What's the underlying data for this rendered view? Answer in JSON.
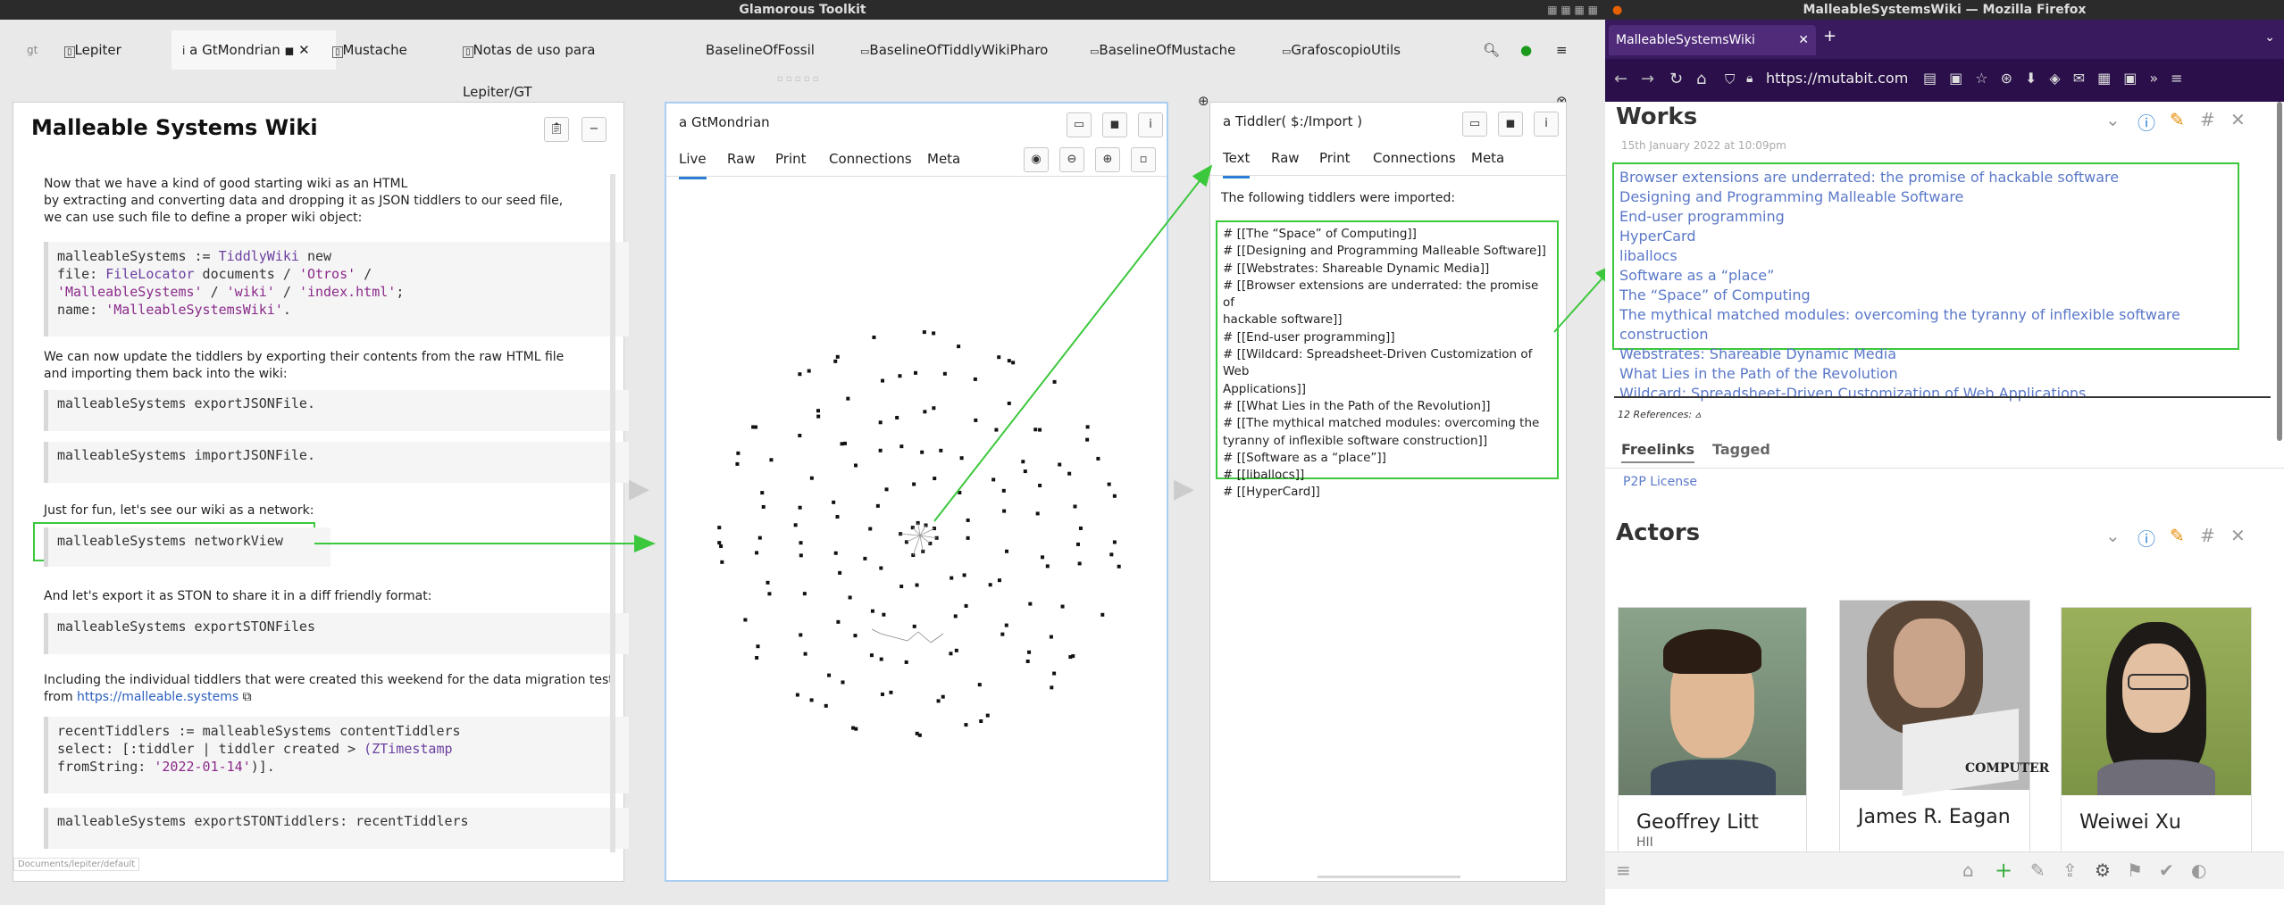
{
  "desktop": {},
  "gt": {
    "window_title": "Glamorous Toolkit",
    "tabs": [
      {
        "label": "Lepiter"
      },
      {
        "label": "a GtMondrian"
      },
      {
        "label": "Mustache"
      },
      {
        "label": "Notas de uso para Lepiter/GT"
      },
      {
        "label": "BaselineOfFossil"
      },
      {
        "label": "BaselineOfTiddlyWikiPharo"
      },
      {
        "label": "BaselineOfMustache"
      },
      {
        "label": "GrafoscopioUtils"
      }
    ],
    "page": {
      "title": "Malleable Systems Wiki",
      "p1_line1": "Now that we have a kind of good starting wiki as an HTML",
      "p1_line2": "by extracting and converting data and dropping it as JSON tiddlers to our seed file,",
      "p1_line3": "we can use such file to define a proper wiki object:",
      "code1_line1_a": "malleableSystems := ",
      "code1_line1_b": "TiddlyWiki",
      "code1_line1_c": " new",
      "code1_line2_a": "    file: ",
      "code1_line2_b": "FileLocator",
      "code1_line2_c": " documents / ",
      "code1_line2_d": "'Otros'",
      "code1_line2_e": " /",
      "code1_line3_a": "'MalleableSystems'",
      "code1_line3_b": " / ",
      "code1_line3_c": "'wiki'",
      "code1_line3_d": " / ",
      "code1_line3_e": "'index.html'",
      "code1_line3_f": ";",
      "code1_line4_a": "    name: ",
      "code1_line4_b": "'MalleableSystemsWiki'",
      "code1_line4_c": ".",
      "p2_line1": "We can now update the tiddlers by exporting their contents from the raw HTML file",
      "p2_line2": "and importing them back into the wiki:",
      "code2": "malleableSystems exportJSONFile.",
      "code3": "malleableSystems importJSONFile.",
      "p3": "Just for fun, let's see our wiki as a network:",
      "code4": "malleableSystems networkView",
      "p4": "And let's export it as STON to share it in a diff friendly format:",
      "code5": "malleableSystems exportSTONFiles",
      "p5_line1": "Including the individual tiddlers that were created this weekend for the data migration test",
      "p5_line2_a": "from ",
      "p5_line2_link": "https://malleable.systems",
      "code6_line1_a": "recentTiddlers := ",
      "code6_line1_b": "malleableSystems contentTiddlers",
      "code6_line2_a": "    select: [:tiddler | tiddler created > ",
      "code6_line2_b": "(ZTimestamp",
      "code6_line3_a": "fromString: ",
      "code6_line3_b": "'2022-01-14'",
      "code6_line3_c": ")].",
      "code7_a": "malleableSystems exportSTONTiddlers: ",
      "code7_b": "recentTiddlers",
      "footer_path": "Documents/lepiter/default"
    },
    "mondrian": {
      "title": "a GtMondrian",
      "subtabs": [
        "Live",
        "Raw",
        "Print",
        "Connections",
        "Meta"
      ]
    },
    "tiddler": {
      "title": "a Tiddler( $:/Import )",
      "subtabs": [
        "Text",
        "Raw",
        "Print",
        "Connections",
        "Meta"
      ],
      "intro": "The following tiddlers were imported:",
      "lines": [
        "# [[The “Space” of Computing]]",
        "# [[Designing and Programming Malleable Software]]",
        "# [[Webstrates: Shareable Dynamic Media]]",
        "# [[Browser extensions are underrated: the promise of",
        "hackable software]]",
        "# [[End-user programming]]",
        "# [[Wildcard: Spreadsheet-Driven Customization of Web",
        "Applications]]",
        "# [[What Lies in the Path of the Revolution]]",
        "# [[The mythical matched modules: overcoming the",
        "tyranny of inflexible software construction]]",
        "# [[Software as a “place”]]",
        "# [[liballocs]]",
        "# [[HyperCard]]"
      ]
    }
  },
  "firefox": {
    "window_title": "MalleableSystemsWiki — Mozilla Firefox",
    "tab_label": "MalleableSystemsWiki",
    "url": "https://mutabit.com",
    "works": {
      "title": "Works",
      "date": "15th January 2022 at 10:09pm",
      "items": [
        "Browser extensions are underrated: the promise of hackable software",
        "Designing and Programming Malleable Software",
        "End-user programming",
        "HyperCard",
        "liballocs",
        "Software as a “place”",
        "The “Space” of Computing",
        "The mythical matched modules: overcoming the tyranny of inflexible software construction",
        "Webstrates: Shareable Dynamic Media",
        "What Lies in the Path of the Revolution",
        "Wildcard: Spreadsheet-Driven Customization of Web Applications"
      ],
      "references": "12 References:",
      "tab_freelinks": "Freelinks",
      "tab_tagged": "Tagged",
      "freelink": "P2P License"
    },
    "actors": {
      "title": "Actors",
      "people": [
        {
          "name": "Geoffrey Litt",
          "sub": "HII"
        },
        {
          "name": "James R. Eagan",
          "sub": ""
        },
        {
          "name": "Weiwei Xu",
          "sub": ""
        }
      ],
      "book_text": "COMPUTER"
    },
    "colors": {
      "accent": "#3cc83c",
      "tw_link": "#5a78c8",
      "ff_purple": "#3a1a5e"
    }
  }
}
